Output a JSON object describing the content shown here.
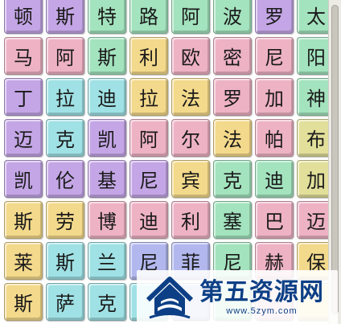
{
  "colors": {
    "purple": "#c4a6e6",
    "pink": "#eeb2c5",
    "green": "#a3e3be",
    "yellow": "#f3d98b",
    "teal": "#9fe1e4",
    "olive": "#e2df9b",
    "blue": "#b2b8ee",
    "brand_blue": "#0c3f86"
  },
  "grid": [
    [
      {
        "c": "顿",
        "col": "purple"
      },
      {
        "c": "斯",
        "col": "purple"
      },
      {
        "c": "特",
        "col": "green"
      },
      {
        "c": "路",
        "col": "green"
      },
      {
        "c": "阿",
        "col": "green"
      },
      {
        "c": "波",
        "col": "green"
      },
      {
        "c": "罗",
        "col": "purple"
      },
      {
        "c": "太",
        "col": "green"
      }
    ],
    [
      {
        "c": "马",
        "col": "pink"
      },
      {
        "c": "阿",
        "col": "pink"
      },
      {
        "c": "斯",
        "col": "green"
      },
      {
        "c": "利",
        "col": "yellow"
      },
      {
        "c": "欧",
        "col": "pink"
      },
      {
        "c": "密",
        "col": "pink"
      },
      {
        "c": "尼",
        "col": "pink"
      },
      {
        "c": "阳",
        "col": "green"
      }
    ],
    [
      {
        "c": "丁",
        "col": "purple"
      },
      {
        "c": "拉",
        "col": "teal"
      },
      {
        "c": "迪",
        "col": "teal"
      },
      {
        "c": "拉",
        "col": "yellow"
      },
      {
        "c": "法",
        "col": "yellow"
      },
      {
        "c": "罗",
        "col": "pink"
      },
      {
        "c": "加",
        "col": "pink"
      },
      {
        "c": "神",
        "col": "green"
      }
    ],
    [
      {
        "c": "迈",
        "col": "purple"
      },
      {
        "c": "克",
        "col": "teal"
      },
      {
        "c": "凯",
        "col": "purple"
      },
      {
        "c": "阿",
        "col": "pink"
      },
      {
        "c": "尔",
        "col": "pink"
      },
      {
        "c": "法",
        "col": "yellow"
      },
      {
        "c": "帕",
        "col": "pink"
      },
      {
        "c": "布",
        "col": "olive"
      }
    ],
    [
      {
        "c": "凯",
        "col": "purple"
      },
      {
        "c": "伦",
        "col": "purple"
      },
      {
        "c": "基",
        "col": "purple"
      },
      {
        "c": "尼",
        "col": "purple"
      },
      {
        "c": "宾",
        "col": "yellow"
      },
      {
        "c": "克",
        "col": "green"
      },
      {
        "c": "迪",
        "col": "green"
      },
      {
        "c": "加",
        "col": "olive"
      }
    ],
    [
      {
        "c": "斯",
        "col": "yellow"
      },
      {
        "c": "劳",
        "col": "yellow"
      },
      {
        "c": "博",
        "col": "pink"
      },
      {
        "c": "迪",
        "col": "pink"
      },
      {
        "c": "利",
        "col": "pink"
      },
      {
        "c": "塞",
        "col": "green"
      },
      {
        "c": "巴",
        "col": "pink"
      },
      {
        "c": "迈",
        "col": "pink"
      }
    ],
    [
      {
        "c": "莱",
        "col": "yellow"
      },
      {
        "c": "斯",
        "col": "teal"
      },
      {
        "c": "兰",
        "col": "teal"
      },
      {
        "c": "尼",
        "col": "blue"
      },
      {
        "c": "菲",
        "col": "blue"
      },
      {
        "c": "尼",
        "col": "green"
      },
      {
        "c": "赫",
        "col": "pink"
      },
      {
        "c": "保",
        "col": "yellow"
      }
    ],
    [
      {
        "c": "斯",
        "col": "yellow"
      },
      {
        "c": "萨",
        "col": "teal"
      },
      {
        "c": "克",
        "col": "teal"
      },
      {
        "c": "",
        "col": "teal"
      },
      {
        "c": "",
        "col": "blue"
      },
      {
        "c": "",
        "col": "green"
      },
      {
        "c": "",
        "col": "pink"
      },
      {
        "c": "",
        "col": "yellow"
      }
    ]
  ],
  "watermark": {
    "title": "第五资源网",
    "url": "www.5zym.com"
  }
}
